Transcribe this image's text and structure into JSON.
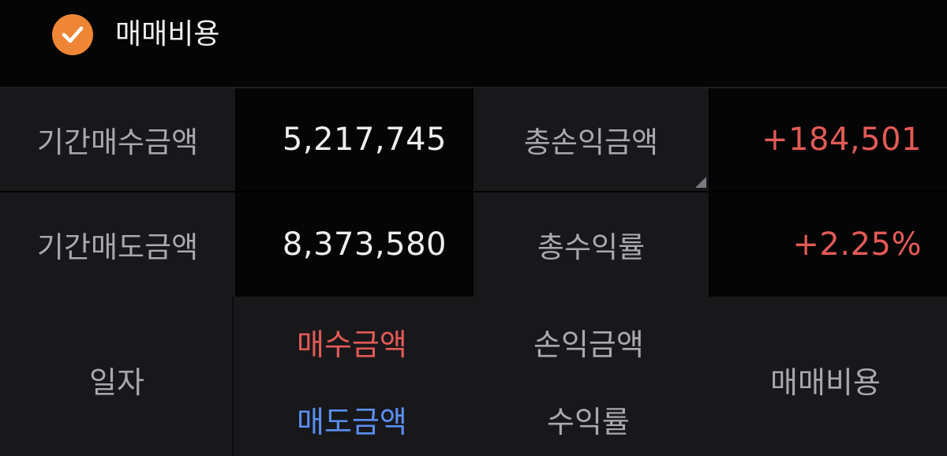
{
  "top": {
    "checkbox_checked": true,
    "label": "매매비용",
    "accent_color": "#ef8636"
  },
  "summary": {
    "period_buy_label": "기간매수금액",
    "period_buy_value": "5,217,745",
    "total_pnl_label": "총손익금액",
    "total_pnl_value": "+184,501",
    "period_sell_label": "기간매도금액",
    "period_sell_value": "8,373,580",
    "total_return_label": "총수익률",
    "total_return_value": "+2.25%"
  },
  "table_header": {
    "date": "일자",
    "buy_amount": "매수금액",
    "sell_amount": "매도금액",
    "pnl_amount": "손익금액",
    "return_rate": "수익률",
    "trade_cost": "매매비용"
  },
  "colors": {
    "positive": "#e35a57",
    "sell": "#5a8ef2",
    "label": "#a9a9ad",
    "background": "#000000",
    "cell_dark": "#050505",
    "cell_label": "#18181b"
  }
}
